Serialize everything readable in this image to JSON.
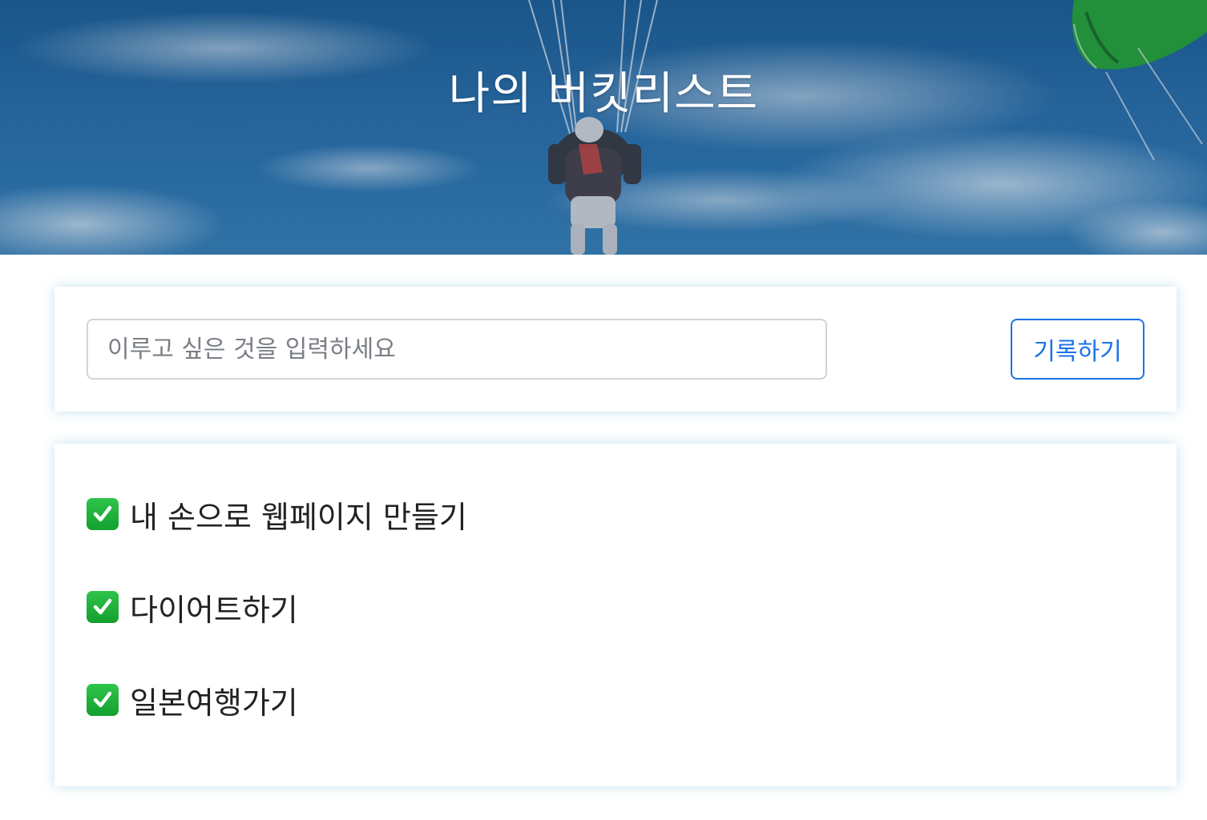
{
  "header": {
    "title": "나의 버킷리스트"
  },
  "form": {
    "placeholder": "이루고 싶은 것을 입력하세요",
    "value": "",
    "submit_label": "기록하기"
  },
  "bucket_list": {
    "items": [
      {
        "text": "내 손으로 웹페이지 만들기",
        "icon": "check-mark-button-icon"
      },
      {
        "text": "다이어트하기",
        "icon": "check-mark-button-icon"
      },
      {
        "text": "일본여행가기",
        "icon": "check-mark-button-icon"
      }
    ]
  },
  "colors": {
    "accent": "#1a73e8",
    "check": "#13a02f",
    "sky": "#2a6ea8"
  }
}
